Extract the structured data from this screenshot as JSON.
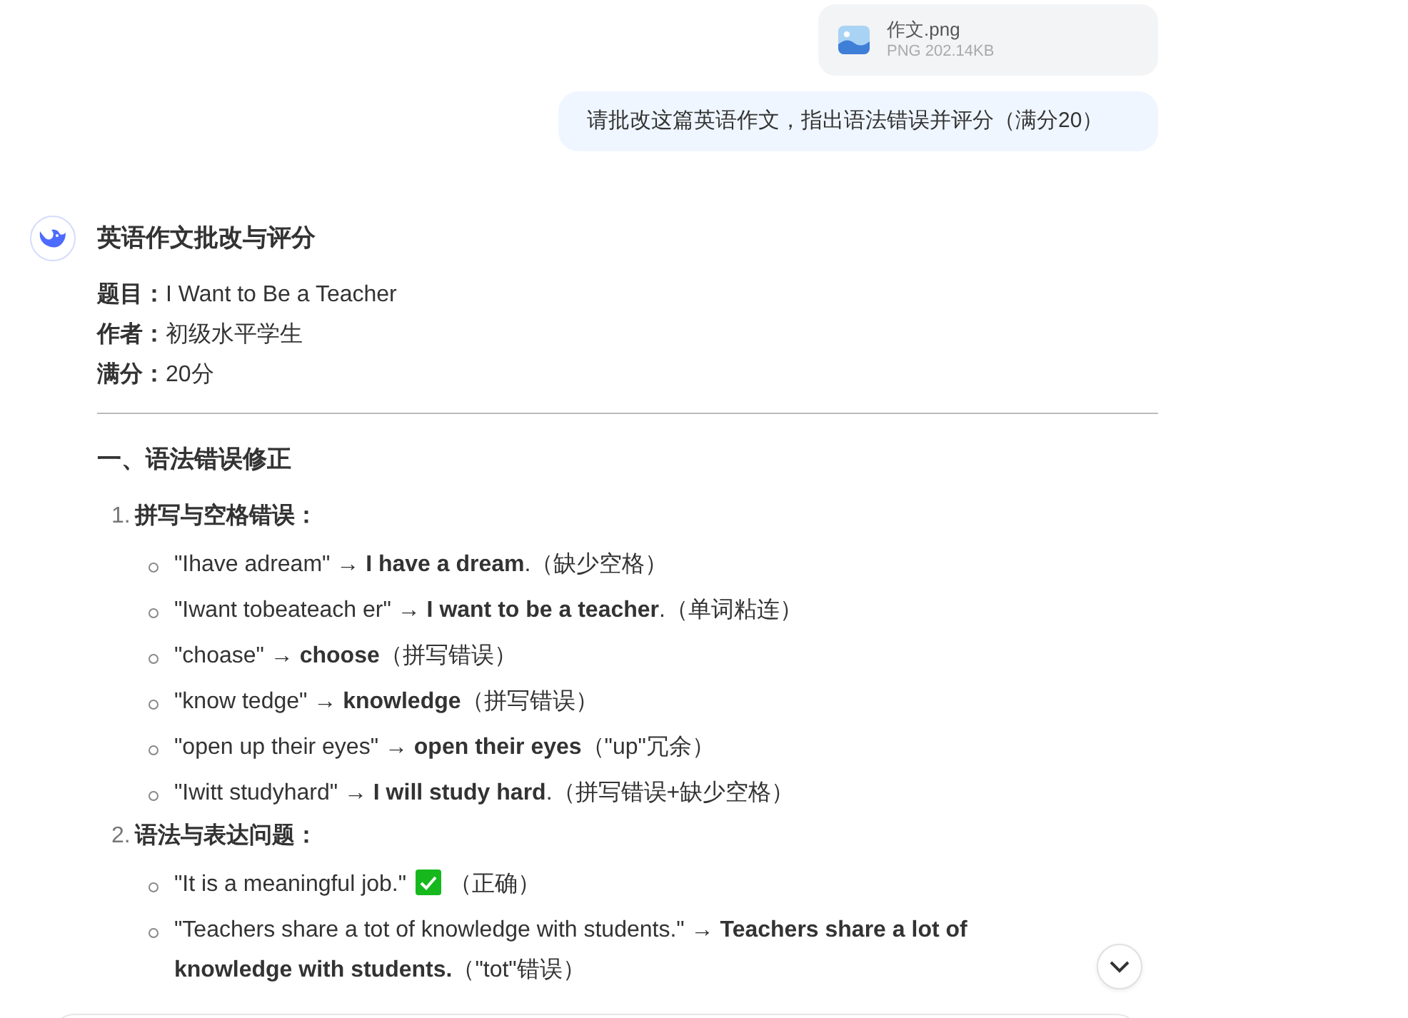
{
  "attachment": {
    "file_name": "作文.png",
    "file_info": "PNG 202.14KB"
  },
  "user_message": "请批改这篇英语作文，指出语法错误并评分（满分20）",
  "reply": {
    "title": "英语作文批改与评分",
    "meta": [
      {
        "label": "题目：",
        "value": "I Want to Be a Teacher"
      },
      {
        "label": "作者：",
        "value": "初级水平学生"
      },
      {
        "label": "满分：",
        "value": "20分"
      }
    ],
    "section_heading": "一、语法错误修正",
    "groups": [
      {
        "number": "1.",
        "heading": "拼写与空格错误：",
        "items": [
          {
            "kind": "fix",
            "text": "\"Ihave adream\" → **I have a dream**.（缺少空格）"
          },
          {
            "kind": "fix",
            "text": "\"Iwant tobeateach er\" → **I want to be a teacher**.（单词粘连）"
          },
          {
            "kind": "fix",
            "text": "\"choase\" → **choose**（拼写错误）"
          },
          {
            "kind": "fix",
            "text": "\"know tedge\" → **knowledge**（拼写错误）"
          },
          {
            "kind": "fix",
            "text": "\"open up their eyes\" → **open their eyes**（\"up\"冗余）"
          },
          {
            "kind": "fix",
            "text": "\"Iwitt studyhard\" → **I will study hard**.（拼写错误+缺少空格）"
          }
        ]
      },
      {
        "number": "2.",
        "heading": "语法与表达问题：",
        "items": [
          {
            "kind": "correct",
            "text": "\"It is a meaningful job.\"",
            "note": "（正确）"
          },
          {
            "kind": "fix",
            "text": "\"Teachers share a tot of knowledge with students.\" → **Teachers share a lot of knowledge with students.**（\"tot\"错误）"
          }
        ]
      }
    ]
  }
}
